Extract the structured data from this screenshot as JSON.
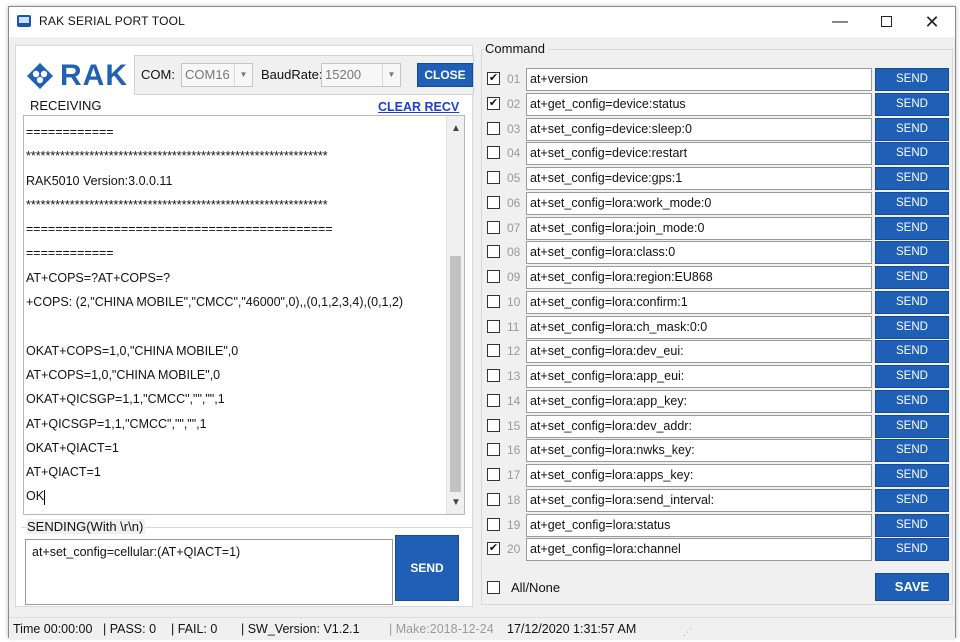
{
  "window": {
    "title": "RAK SERIAL PORT TOOL",
    "minimize": "—",
    "close": "✕"
  },
  "brand": "RAK",
  "port": {
    "com_label": "COM:",
    "com_value": "COM16",
    "baud_label": "BaudRate:",
    "baud_value": "15200",
    "close_label": "CLOSE"
  },
  "receiving": {
    "label": "RECEIVING",
    "clear_label": "CLEAR RECV",
    "lines": [
      "============",
      "**************************************************************",
      "RAK5010 Version:3.0.0.11",
      "**************************************************************",
      "==========================================",
      "============",
      "AT+COPS=?AT+COPS=?",
      "+COPS: (2,\"CHINA MOBILE\",\"CMCC\",\"46000\",0),,(0,1,2,3,4),(0,1,2)",
      "",
      "OKAT+COPS=1,0,\"CHINA MOBILE\",0",
      "AT+COPS=1,0,\"CHINA MOBILE\",0",
      "OKAT+QICSGP=1,1,\"CMCC\",\"\",\"\",1",
      "AT+QICSGP=1,1,\"CMCC\",\"\",\"\",1",
      "OKAT+QIACT=1",
      "AT+QIACT=1",
      "OK"
    ]
  },
  "sending": {
    "label": "SENDING(With \\r\\n)",
    "value": "at+set_config=cellular:(AT+QIACT=1)",
    "send_label": "SEND"
  },
  "commands": {
    "label": "Command",
    "send_label": "SEND",
    "rows": [
      {
        "num": "01",
        "checked": true,
        "cmd": "at+version"
      },
      {
        "num": "02",
        "checked": true,
        "cmd": "at+get_config=device:status"
      },
      {
        "num": "03",
        "checked": false,
        "cmd": "at+set_config=device:sleep:0"
      },
      {
        "num": "04",
        "checked": false,
        "cmd": "at+set_config=device:restart"
      },
      {
        "num": "05",
        "checked": false,
        "cmd": "at+set_config=device:gps:1"
      },
      {
        "num": "06",
        "checked": false,
        "cmd": "at+set_config=lora:work_mode:0"
      },
      {
        "num": "07",
        "checked": false,
        "cmd": "at+set_config=lora:join_mode:0"
      },
      {
        "num": "08",
        "checked": false,
        "cmd": "at+set_config=lora:class:0"
      },
      {
        "num": "09",
        "checked": false,
        "cmd": "at+set_config=lora:region:EU868"
      },
      {
        "num": "10",
        "checked": false,
        "cmd": "at+set_config=lora:confirm:1"
      },
      {
        "num": "11",
        "checked": false,
        "cmd": "at+set_config=lora:ch_mask:0:0"
      },
      {
        "num": "12",
        "checked": false,
        "cmd": "at+set_config=lora:dev_eui:"
      },
      {
        "num": "13",
        "checked": false,
        "cmd": "at+set_config=lora:app_eui:"
      },
      {
        "num": "14",
        "checked": false,
        "cmd": "at+set_config=lora:app_key:"
      },
      {
        "num": "15",
        "checked": false,
        "cmd": "at+set_config=lora:dev_addr:"
      },
      {
        "num": "16",
        "checked": false,
        "cmd": "at+set_config=lora:nwks_key:"
      },
      {
        "num": "17",
        "checked": false,
        "cmd": "at+set_config=lora:apps_key:"
      },
      {
        "num": "18",
        "checked": false,
        "cmd": "at+set_config=lora:send_interval:"
      },
      {
        "num": "19",
        "checked": false,
        "cmd": "at+get_config=lora:status"
      },
      {
        "num": "20",
        "checked": true,
        "cmd": "at+get_config=lora:channel"
      }
    ],
    "all_none_label": "All/None",
    "save_label": "SAVE"
  },
  "status": {
    "time": "Time  00:00:00",
    "pass": "| PASS:  0",
    "fail": "| FAIL:  0",
    "sw_version": "| SW_Version:  V1.2.1",
    "make": "| Make:2018-12-24",
    "datetime": "17/12/2020 1:31:57 AM"
  },
  "colors": {
    "accent_blue": "#1f5fb5",
    "link_blue": "#1a3fd4",
    "brand_blue": "#1f61b3"
  }
}
